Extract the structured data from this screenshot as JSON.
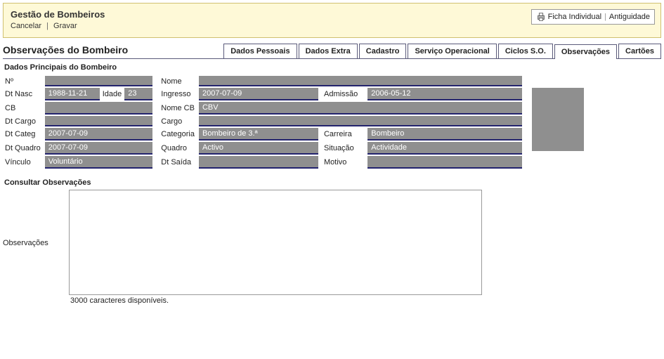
{
  "header": {
    "title": "Gestão de Bombeiros",
    "cancel": "Cancelar",
    "save": "Gravar",
    "ficha": "Ficha Individual",
    "antig": "Antiguidade"
  },
  "pageTitle": "Observações do Bombeiro",
  "tabs": {
    "t0": "Dados Pessoais",
    "t1": "Dados Extra",
    "t2": "Cadastro",
    "t3": "Serviço Operacional",
    "t4": "Ciclos S.O.",
    "t5": "Observações",
    "t6": "Cartões"
  },
  "sectionMain": "Dados Principais do Bombeiro",
  "labels": {
    "no": "Nº",
    "nome": "Nome",
    "dtNasc": "Dt Nasc",
    "idade": "Idade",
    "ingresso": "Ingresso",
    "admissao": "Admissão",
    "cb": "CB",
    "nomeCb": "Nome CB",
    "dtCargo": "Dt Cargo",
    "cargo": "Cargo",
    "dtCateg": "Dt Categ",
    "categoria": "Categoria",
    "carreira": "Carreira",
    "dtQuadro": "Dt Quadro",
    "quadro": "Quadro",
    "situacao": "Situação",
    "vinculo": "Vínculo",
    "dtSaida": "Dt Saída",
    "motivo": "Motivo"
  },
  "values": {
    "no": "",
    "nome": "",
    "dtNasc": "1988-11-21",
    "idade": "23",
    "ingresso": "2007-07-09",
    "admissao": "2006-05-12",
    "cb": "",
    "nomeCb": "CBV",
    "dtCargo": "",
    "cargo": "",
    "dtCateg": "2007-07-09",
    "categoria": "Bombeiro de 3.ª",
    "carreira": "Bombeiro",
    "dtQuadro": "2007-07-09",
    "quadro": "Activo",
    "situacao": "Actividade",
    "vinculo": "Voluntário",
    "dtSaida": "",
    "motivo": ""
  },
  "obs": {
    "section": "Consultar Observações",
    "label": "Observações",
    "value": "",
    "counter": "3000 caracteres disponíveis."
  }
}
